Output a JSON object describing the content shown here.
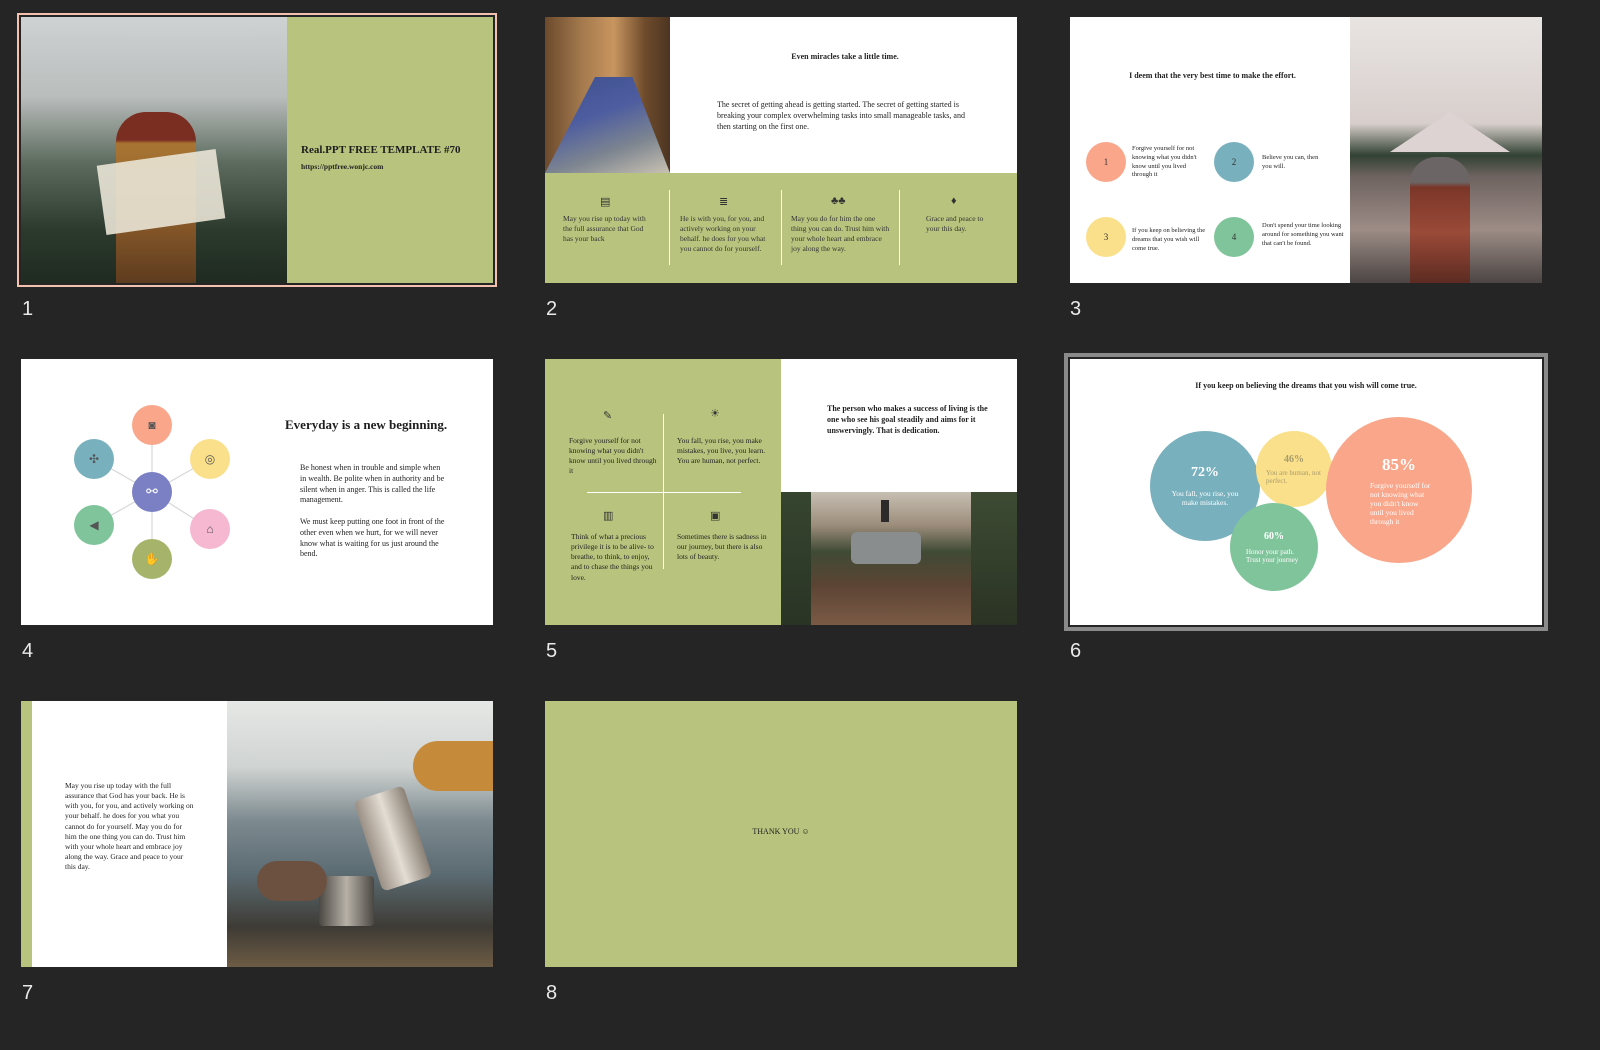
{
  "colors": {
    "green": "#b8c47e",
    "salmon": "#f9a68a",
    "teal": "#78b0bd",
    "yellow": "#fbe08c",
    "mint": "#80c49b",
    "purple": "#7b7fc4",
    "pink": "#f6b7d0",
    "olive": "#a5b46a"
  },
  "slide1": {
    "title": "Real.PPT FREE TEMPLATE #70",
    "url": "https://pptfree.wonjc.com"
  },
  "slide2": {
    "heading": "Even miracles take a little time.",
    "body": "The secret of  getting ahead is getting started. The secret of  getting started is breaking your complex overwhelming tasks into small manageable tasks, and then starting on the first one.",
    "cols": [
      {
        "icon": "book-icon",
        "text": "May you rise up today with the full assurance that God has your back"
      },
      {
        "icon": "stack-icon",
        "text": "He is with you, for you, and actively working on your behalf. he does for you what you cannot do for yourself."
      },
      {
        "icon": "trees-icon",
        "text": "May you do for him the one thing you can do. Trust him with your whole heart and embrace joy along the way."
      },
      {
        "icon": "microphone-icon",
        "text": "Grace and peace to your this day."
      }
    ]
  },
  "slide3": {
    "heading": "I deem that the very best time to make the effort.",
    "items": [
      {
        "n": "1",
        "text": "Forgive yourself  for not knowing what you didn't know until you lived through it"
      },
      {
        "n": "2",
        "text": "Believe you can, then you will."
      },
      {
        "n": "3",
        "text": "If you keep on believing the dreams that you wish will come true."
      },
      {
        "n": "4",
        "text": "Don't spend your time looking around for something you want that can't be found."
      }
    ]
  },
  "slide4": {
    "heading": "Everyday is a  new beginning.",
    "p1": "Be honest when in trouble and simple when in wealth. Be polite when in authority and be silent when in anger. This is called the life management.",
    "p2": "We must keep putting one foot in front of  the other even when we hurt, for we will never know what is waiting for us just around the bend.",
    "icons": [
      "link-icon",
      "camera-icon",
      "target-icon",
      "bank-icon",
      "hand-icon",
      "megaphone-icon",
      "puzzle-icon"
    ]
  },
  "slide5": {
    "quote": "The person who makes a success of living is the one who see his goal steadily and aims for it unswervingly. That is dedication.",
    "cells": [
      {
        "icon": "edit-icon",
        "text": "Forgive yourself  for not knowing what you didn't know until you lived through it"
      },
      {
        "icon": "lightbulb-icon",
        "text": "You fall, you rise, you make mistakes, you live, you learn. You are human, not perfect."
      },
      {
        "icon": "trash-icon",
        "text": "Think of  what a precious privilege it is to be alive- to breathe, to think, to enjoy, and to chase the things you love."
      },
      {
        "icon": "document-icon",
        "text": "Sometimes there is sadness in our journey, but there is also lots of beauty."
      }
    ]
  },
  "slide6": {
    "heading": "If you keep on believing the dreams that you wish will come true.",
    "bubbles": [
      {
        "pct": "72%",
        "text": "You fall, you rise, you make mistakes."
      },
      {
        "pct": "46%",
        "text": "You are human, not perfect."
      },
      {
        "pct": "60%",
        "text": "Honor your path. Trust your journey"
      },
      {
        "pct": "85%",
        "text": "Forgive yourself for not knowing what you didn't know until you lived through it"
      }
    ]
  },
  "slide7": {
    "body": "May you rise up today with the full assurance that God has your back. He is with you, for you, and actively working on your behalf. he does for you what you cannot do for yourself. May you do for him the one thing you can do. Trust him with your whole heart and embrace joy along the way. Grace and peace to your this day."
  },
  "slide8": {
    "text": "THANK YOU ☺"
  },
  "numbers": [
    "1",
    "2",
    "3",
    "4",
    "5",
    "6",
    "7",
    "8"
  ]
}
